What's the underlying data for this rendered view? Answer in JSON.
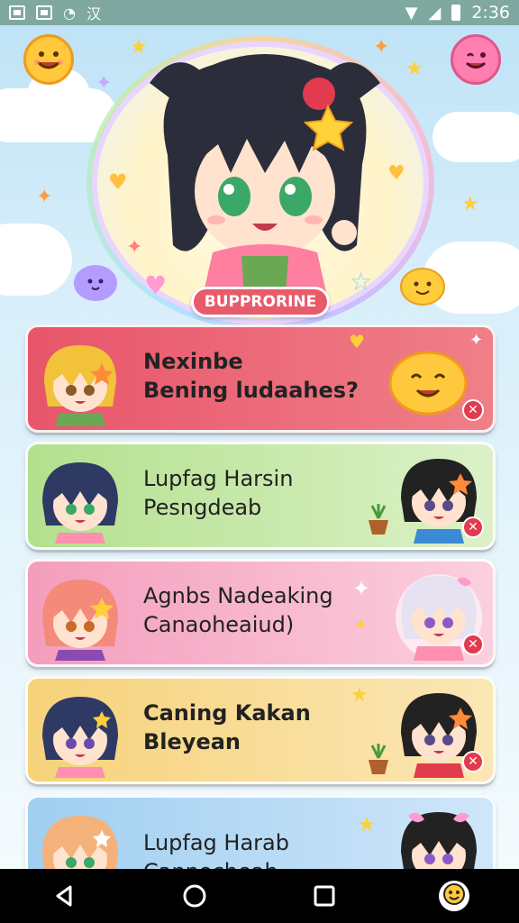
{
  "status_bar": {
    "time": "2:36",
    "left_icons": [
      "notification-box-icon",
      "message-icon",
      "clock-icon",
      "language-icon"
    ],
    "right_icons": [
      "wifi-icon",
      "signal-icon",
      "battery-icon"
    ]
  },
  "hero": {
    "badge_label": "BUPPRORINE",
    "corner_left_icon": "smiley-icon",
    "corner_right_icon": "chat-smiley-icon"
  },
  "cards": [
    {
      "line1": "Nexinbe",
      "line2": "Bening ludaahes?",
      "bg": "#ea5f72",
      "right_icon": "happy-blob-icon"
    },
    {
      "line1": "Lupfag Harsin",
      "line2": "Pesngdeab",
      "bg": "#bfe6a3"
    },
    {
      "line1": "Agnbs Nadeaking",
      "line2": "Canaoheaiud)",
      "bg": "#f6a9c4"
    },
    {
      "line1": "Caning Kakan",
      "line2": "Bleyean",
      "bg": "#f8d98a"
    },
    {
      "line1": "Lupfag Harab",
      "line2": "Cannocheab",
      "bg": "#a7d4f2"
    }
  ],
  "nav": {
    "back_icon": "back-triangle-icon",
    "home_icon": "home-circle-icon",
    "recents_icon": "recents-square-icon",
    "assistant_icon": "emoji-assistant-icon"
  },
  "colors": {
    "status_bar": "#7fa8a0",
    "badge": "#e85b6a",
    "dismiss": "#e23a4f"
  }
}
